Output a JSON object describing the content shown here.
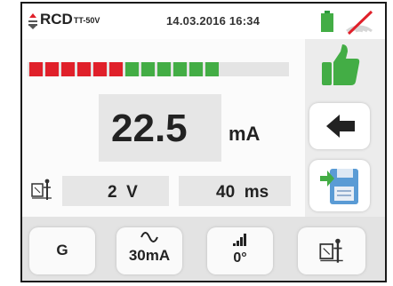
{
  "header": {
    "mode": "RCD",
    "mode_sub": "TT-50V",
    "datetime": "14.03.2016 16:34"
  },
  "bargraph": {
    "red_segments": 6,
    "green_segments": 6,
    "colors": {
      "red": "#e0202a",
      "green": "#43ad45",
      "empty": "#e4e4e4"
    }
  },
  "measurement": {
    "value": "22.5",
    "unit": "mA"
  },
  "voltage": {
    "value": "2",
    "unit": "V"
  },
  "time": {
    "value": "40",
    "unit": "ms"
  },
  "bottom": {
    "g_label": "G",
    "current_label": "30mA",
    "phase_label": "0°"
  },
  "icons": [
    "rcd-symbol-icon",
    "battery-icon",
    "no-signal-icon",
    "thumbs-up-icon",
    "back-arrow-icon",
    "save-icon",
    "earth-probe-icon",
    "sine-wave-icon",
    "ramp-icon"
  ],
  "accent": {
    "ok_green": "#43ad45",
    "alert_red": "#e0202a"
  }
}
